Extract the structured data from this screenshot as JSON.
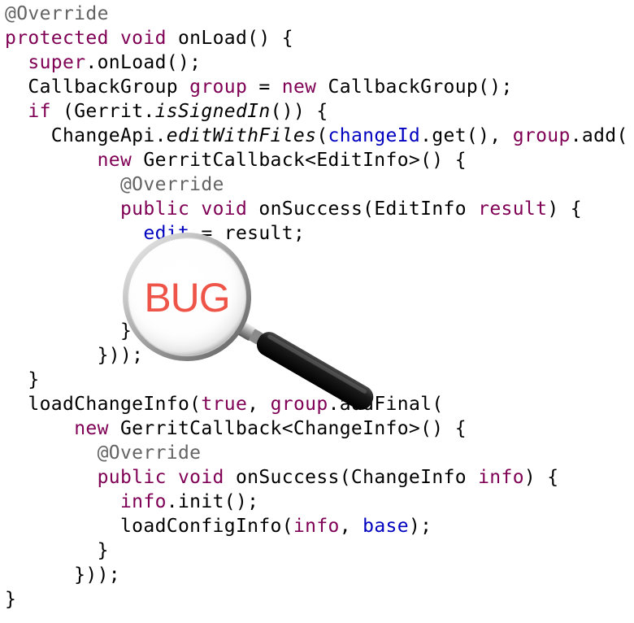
{
  "code": {
    "lines": [
      [
        {
          "text": "@Override",
          "cls": "ann"
        }
      ],
      [
        {
          "text": "protected",
          "cls": "kw"
        },
        {
          "text": " "
        },
        {
          "text": "void",
          "cls": "kw"
        },
        {
          "text": " onLoad() {"
        }
      ],
      [
        {
          "text": "  "
        },
        {
          "text": "super",
          "cls": "kw"
        },
        {
          "text": ".onLoad();"
        }
      ],
      [
        {
          "text": "  CallbackGroup "
        },
        {
          "text": "group",
          "cls": "kw"
        },
        {
          "text": " = "
        },
        {
          "text": "new",
          "cls": "kw"
        },
        {
          "text": " CallbackGroup();"
        }
      ],
      [
        {
          "text": "  "
        },
        {
          "text": "if",
          "cls": "kw"
        },
        {
          "text": " (Gerrit."
        },
        {
          "text": "isSignedIn",
          "cls": "it"
        },
        {
          "text": "()) {"
        }
      ],
      [
        {
          "text": "    ChangeApi."
        },
        {
          "text": "editWithFiles",
          "cls": "it"
        },
        {
          "text": "("
        },
        {
          "text": "changeId",
          "cls": "field"
        },
        {
          "text": ".get(), "
        },
        {
          "text": "group",
          "cls": "kw"
        },
        {
          "text": ".add("
        }
      ],
      [
        {
          "text": "        "
        },
        {
          "text": "new",
          "cls": "kw"
        },
        {
          "text": " GerritCallback<EditInfo>() {"
        }
      ],
      [
        {
          "text": "          "
        },
        {
          "text": "@Override",
          "cls": "ann"
        }
      ],
      [
        {
          "text": "          "
        },
        {
          "text": "public",
          "cls": "kw"
        },
        {
          "text": " "
        },
        {
          "text": "void",
          "cls": "kw"
        },
        {
          "text": " onSuccess(EditInfo "
        },
        {
          "text": "result",
          "cls": "kw"
        },
        {
          "text": ") {"
        }
      ],
      [
        {
          "text": "            "
        },
        {
          "text": "edit",
          "cls": "field"
        },
        {
          "text": " = result;"
        }
      ],
      [
        {
          "text": ""
        }
      ],
      [
        {
          "text": ""
        }
      ],
      [
        {
          "text": ""
        }
      ],
      [
        {
          "text": "          }"
        }
      ],
      [
        {
          "text": "        }));"
        }
      ],
      [
        {
          "text": "  }"
        }
      ],
      [
        {
          "text": "  loadChangeInfo("
        },
        {
          "text": "true",
          "cls": "kw"
        },
        {
          "text": ", "
        },
        {
          "text": "group",
          "cls": "kw"
        },
        {
          "text": ".addFinal("
        }
      ],
      [
        {
          "text": "      "
        },
        {
          "text": "new",
          "cls": "kw"
        },
        {
          "text": " GerritCallback<ChangeInfo>() {"
        }
      ],
      [
        {
          "text": "        "
        },
        {
          "text": "@Override",
          "cls": "ann"
        }
      ],
      [
        {
          "text": "        "
        },
        {
          "text": "public",
          "cls": "kw"
        },
        {
          "text": " "
        },
        {
          "text": "void",
          "cls": "kw"
        },
        {
          "text": " onSuccess(ChangeInfo "
        },
        {
          "text": "info",
          "cls": "kw"
        },
        {
          "text": ") {"
        }
      ],
      [
        {
          "text": "          "
        },
        {
          "text": "info",
          "cls": "kw"
        },
        {
          "text": ".init();"
        }
      ],
      [
        {
          "text": "          loadConfigInfo("
        },
        {
          "text": "info",
          "cls": "kw"
        },
        {
          "text": ", "
        },
        {
          "text": "base",
          "cls": "field"
        },
        {
          "text": ");"
        }
      ],
      [
        {
          "text": "        }"
        }
      ],
      [
        {
          "text": "      }));"
        }
      ],
      [
        {
          "text": "}"
        }
      ]
    ]
  },
  "magnifier": {
    "label": "BUG",
    "icon": "magnifying-glass-icon"
  },
  "colors": {
    "keyword": "#7f0055",
    "annotation": "#646464",
    "field": "#0000c0",
    "text": "#000000",
    "bug_label": "#ee5548"
  }
}
